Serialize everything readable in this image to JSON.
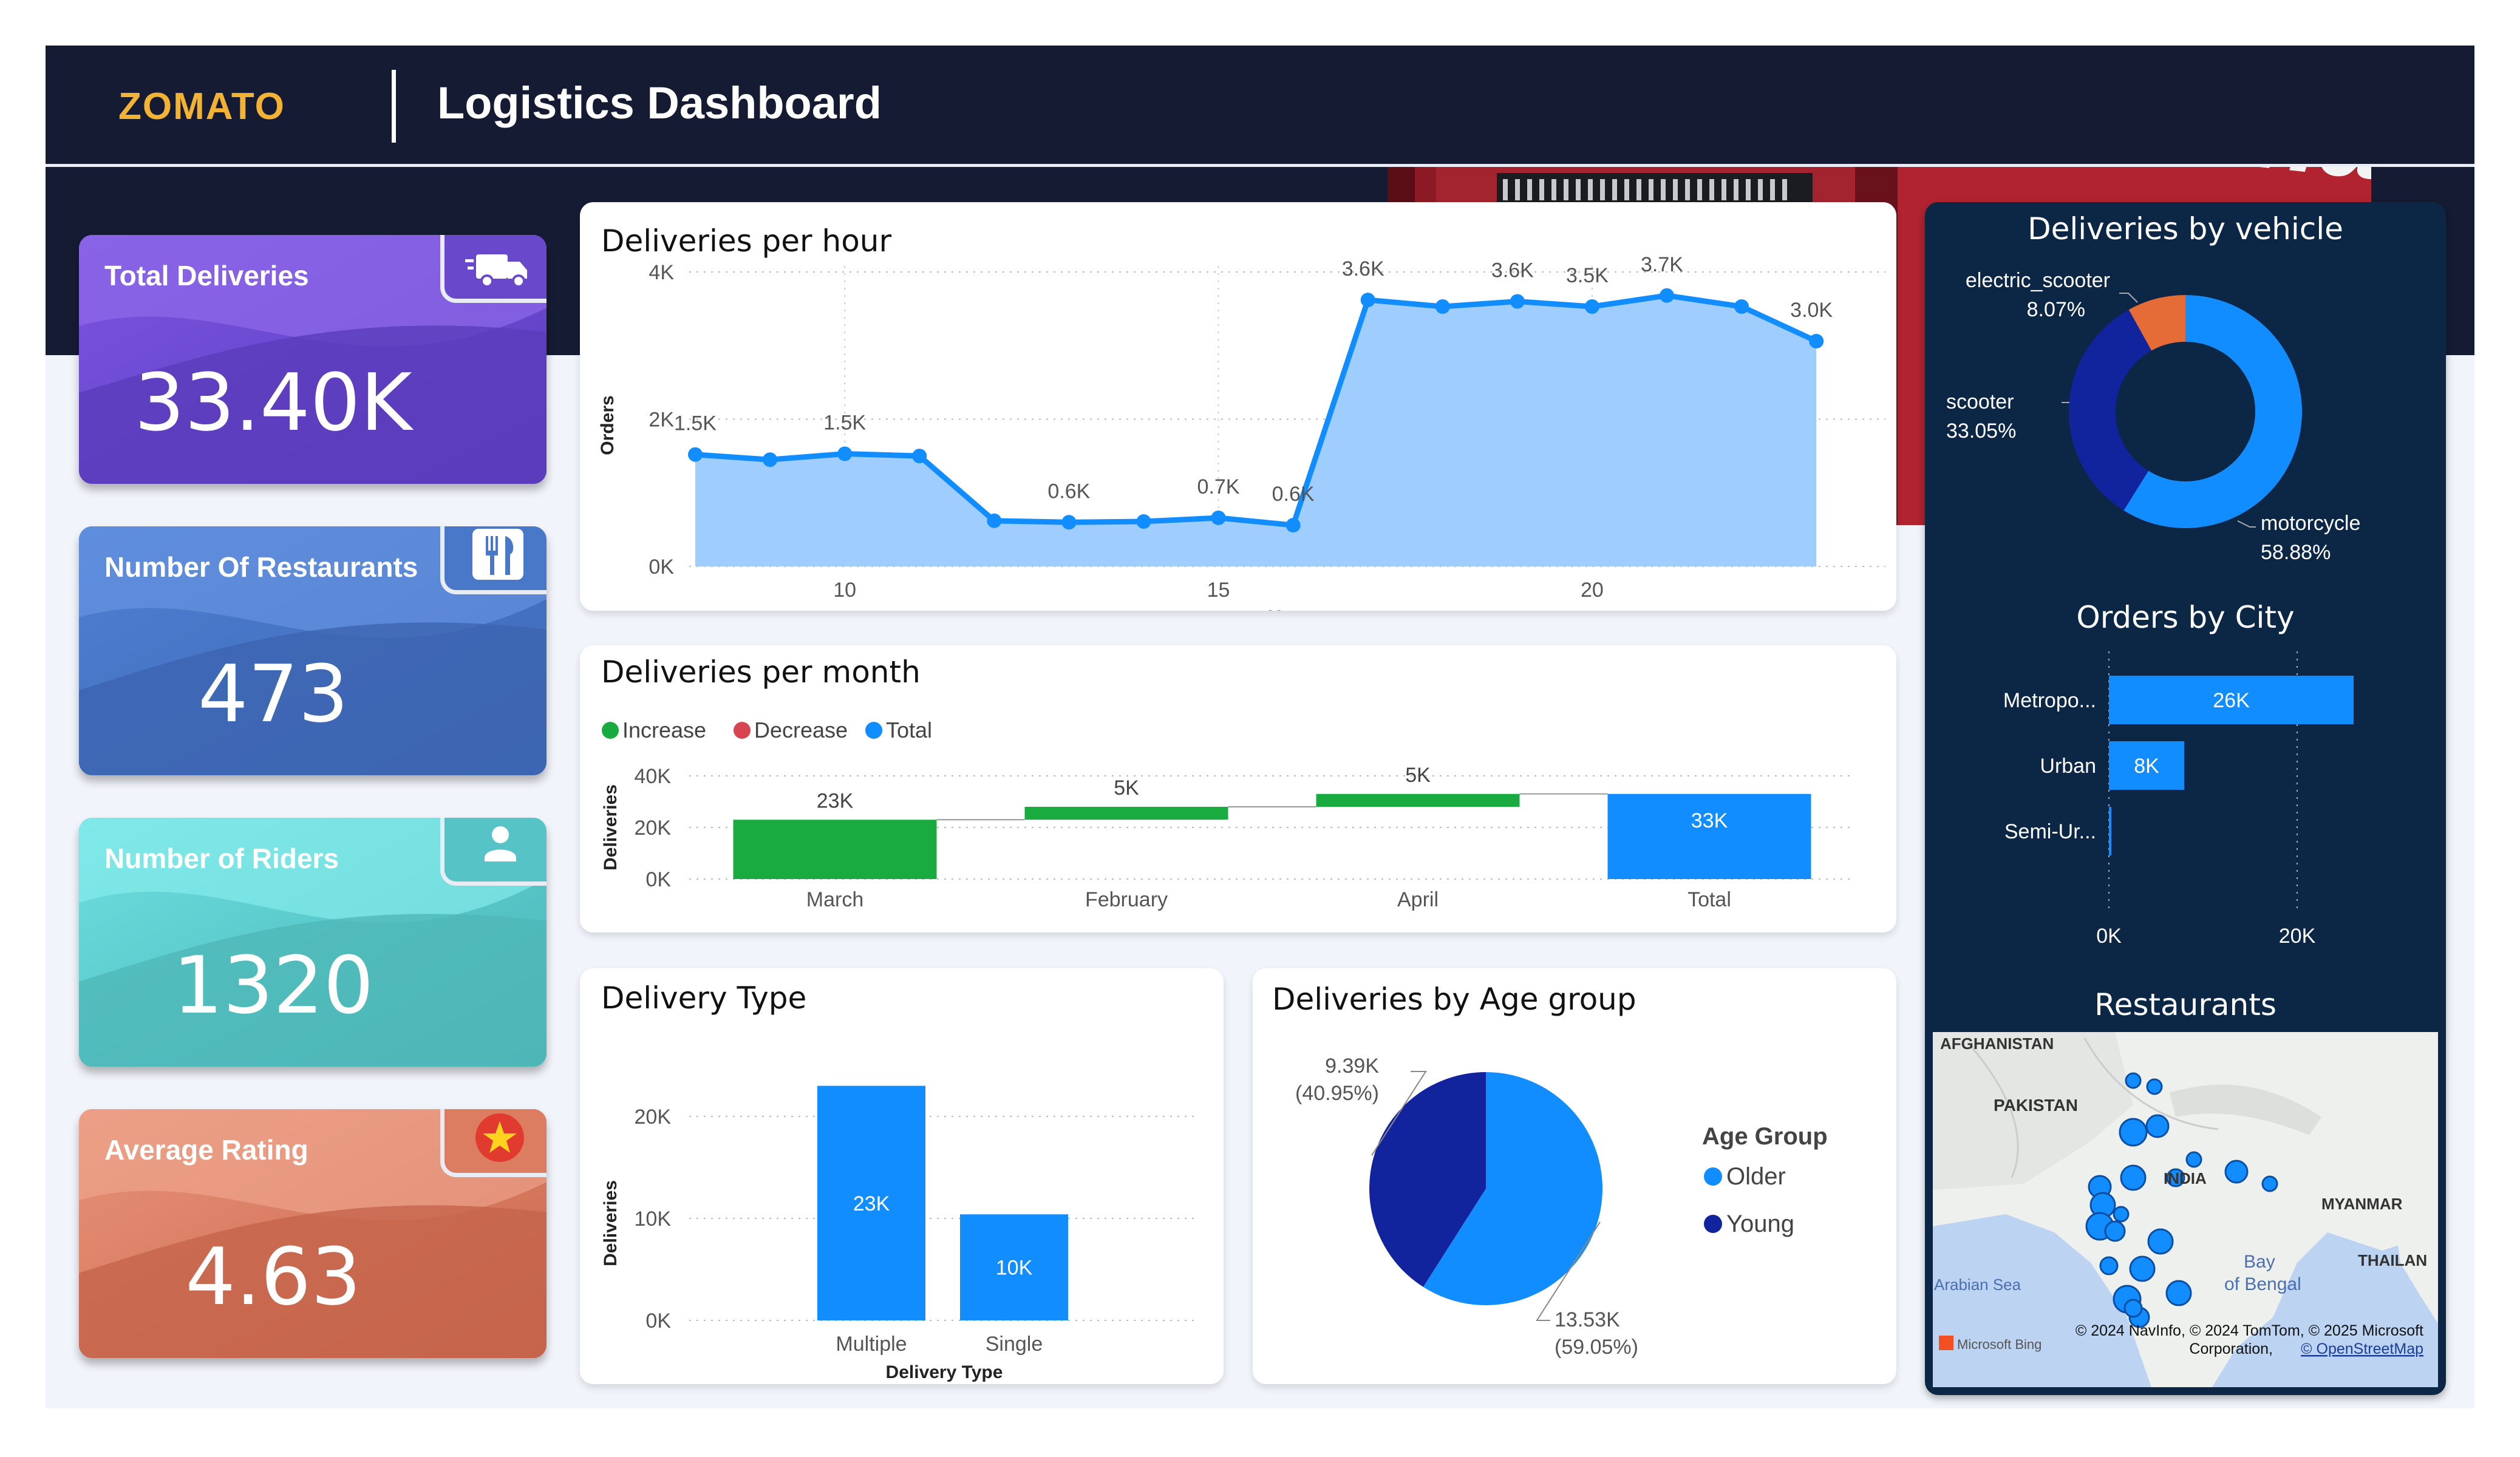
{
  "header": {
    "brand": "ZOMATO",
    "title": "Logistics Dashboard"
  },
  "kpis": [
    {
      "label": "Total Deliveries",
      "value": "33.40K",
      "icon": "truck-icon"
    },
    {
      "label": "Number Of Restaurants",
      "value": "473",
      "icon": "fork-knife-icon"
    },
    {
      "label": "Number of Riders",
      "value": "1320",
      "icon": "person-icon"
    },
    {
      "label": "Average Rating",
      "value": "4.63",
      "icon": "star-icon"
    }
  ],
  "colors": {
    "blue": "#118dff",
    "darkblue": "#12239e",
    "orange": "#e66c37",
    "green": "#1aab40",
    "red": "#d64550"
  },
  "chart_data": [
    {
      "id": "hour",
      "type": "area",
      "title": "Deliveries per hour",
      "xlabel": "Hour",
      "ylabel": "Orders",
      "ylim": [
        0,
        4000
      ],
      "yticks": [
        "0K",
        "2K",
        "4K"
      ],
      "xticks": [
        10,
        15,
        20
      ],
      "x": [
        8,
        9,
        10,
        11,
        12,
        13,
        14,
        15,
        16,
        17,
        18,
        19,
        20,
        21,
        22,
        23
      ],
      "values": [
        1520,
        1450,
        1530,
        1500,
        620,
        600,
        610,
        660,
        560,
        3620,
        3530,
        3600,
        3530,
        3680,
        3530,
        3060
      ],
      "labels": [
        {
          "x": 8,
          "text": "1.5K"
        },
        {
          "x": 10,
          "text": "1.5K"
        },
        {
          "x": 13,
          "text": "0.6K"
        },
        {
          "x": 15,
          "text": "0.7K"
        },
        {
          "x": 16,
          "text": "0.6K"
        },
        {
          "x": 17,
          "text": "3.6K"
        },
        {
          "x": 19,
          "text": "3.6K"
        },
        {
          "x": 20,
          "text": "3.5K"
        },
        {
          "x": 21,
          "text": "3.7K"
        },
        {
          "x": 23,
          "text": "3.0K"
        }
      ]
    },
    {
      "id": "month",
      "type": "waterfall",
      "title": "Deliveries per month",
      "ylabel": "Deliveries",
      "ylim": [
        0,
        40000
      ],
      "yticks": [
        "0K",
        "20K",
        "40K"
      ],
      "legend": [
        "Increase",
        "Decrease",
        "Total"
      ],
      "categories": [
        "March",
        "February",
        "April",
        "Total"
      ],
      "values": [
        23000,
        5000,
        5000,
        33000
      ],
      "labels": [
        "23K",
        "5K",
        "5K",
        "33K"
      ],
      "kinds": [
        "increase",
        "increase",
        "increase",
        "total"
      ]
    },
    {
      "id": "dtype",
      "type": "bar",
      "title": "Delivery Type",
      "xlabel": "Delivery Type",
      "ylabel": "Deliveries",
      "ylim": [
        0,
        25000
      ],
      "yticks": [
        "0K",
        "10K",
        "20K"
      ],
      "categories": [
        "Multiple",
        "Single"
      ],
      "values": [
        23000,
        10400
      ],
      "labels": [
        "23K",
        "10K"
      ]
    },
    {
      "id": "age",
      "type": "pie",
      "title": "Deliveries by Age group",
      "legend_title": "Age Group",
      "categories": [
        "Older",
        "Young"
      ],
      "values": [
        13530,
        9390
      ],
      "labels": [
        "13.53K",
        "9.39K"
      ],
      "percents": [
        "(59.05%)",
        "(40.95%)"
      ]
    },
    {
      "id": "vehicle",
      "type": "pie",
      "title": "Deliveries by vehicle",
      "categories": [
        "motorcycle",
        "scooter",
        "electric_scooter"
      ],
      "values": [
        58.88,
        33.05,
        8.07
      ],
      "percents": [
        "58.88%",
        "33.05%",
        "8.07%"
      ]
    },
    {
      "id": "city",
      "type": "bar",
      "title": "Orders by City",
      "categories": [
        "Metropo...",
        "Urban",
        "Semi-Ur..."
      ],
      "values": [
        26000,
        8000,
        200
      ],
      "labels": [
        "26K",
        "8K",
        ""
      ],
      "xticks": [
        "0K",
        "20K"
      ],
      "xlim": [
        0,
        20000
      ]
    }
  ],
  "map": {
    "title": "Restaurants",
    "places": [
      "AFGHANISTAN",
      "PAKISTAN",
      "INDIA",
      "MYANMAR",
      "THAILAN",
      "Arabian Sea",
      "Bay",
      "of Bengal"
    ],
    "attribution": "© 2024 NavInfo, © 2024 TomTom, © 2025 Microsoft",
    "attribution2": "Corporation, ",
    "osm": "© OpenStreetMap",
    "bing": "Microsoft Bing"
  }
}
